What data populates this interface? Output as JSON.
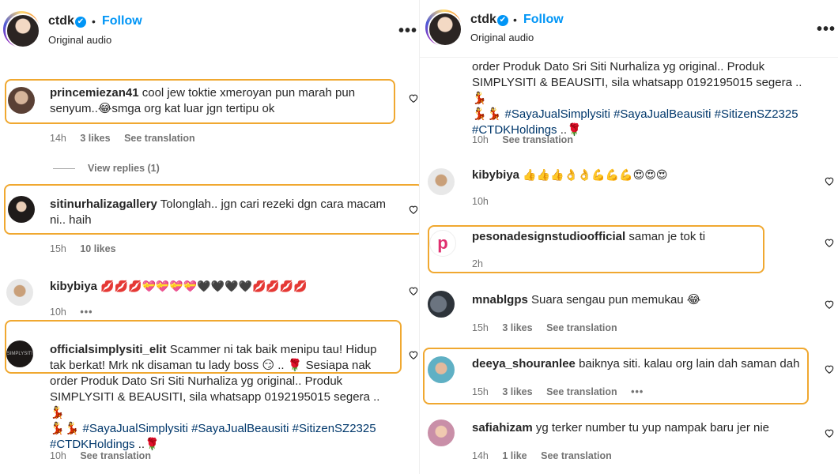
{
  "header": {
    "username": "ctdk",
    "verified_icon": "✔",
    "separator": "•",
    "follow_label": "Follow",
    "audio_label": "Original audio",
    "more_label": "•••"
  },
  "left": {
    "comments": [
      {
        "user": "princemiezan41",
        "text": "cool jew toktie xmeroyan pun marah pun senyum..😂smga org kat luar jgn tertipu ok",
        "time": "14h",
        "likes": "3 likes",
        "translate": "See translation"
      },
      {
        "user": "sitinurhalizagallery",
        "text": "Tolonglah.. jgn cari rezeki dgn cara macam ni.. haih",
        "time": "15h",
        "likes": "10 likes"
      },
      {
        "user": "kibybiya",
        "text": "💋💋💋💝💝💝💝🖤🖤🖤🖤💋💋💋💋",
        "time": "10h",
        "more": "•••"
      },
      {
        "user": "officialsimplysiti_elit",
        "text": "Scammer ni tak baik menipu tau! Hidup tak berkat! Mrk nk disaman tu lady boss 😏 .. 🌹 Sesiapa nak order Produk Dato Sri Siti Nurhaliza yg original.. Produk SIMPLYSITI & BEAUSITI, sila whatsapp 0192195015 segera .. 💃",
        "text_tail": "💃💃",
        "tags": "#SayaJualSimplysiti #SayaJualBeausiti #SitizenSZ2325",
        "tags2": "#CTDKHoldings",
        "tags2_tail": " ..🌹",
        "time": "10h",
        "translate": "See translation"
      }
    ],
    "view_replies": "View replies (1)",
    "avatar_text_official": "SIMPLYSITI"
  },
  "right": {
    "top_fragment": "order Produk Dato Sri Siti Nurhaliza yg original.. Produk SIMPLYSITI & BEAUSITI, sila whatsapp 0192195015 segera .. 💃",
    "top_fragment_tail": "💃💃",
    "top_tags": "#SayaJualSimplysiti #SayaJualBeausiti #SitizenSZ2325",
    "top_tags2": "#CTDKHoldings",
    "top_tags2_tail": " ..🌹",
    "top_time": "10h",
    "top_translate": "See translation",
    "comments": [
      {
        "user": "kibybiya",
        "text": "👍👍👍👌👌💪💪💪😍😍😍",
        "time": "10h"
      },
      {
        "user": "pesonadesignstudioofficial",
        "text": "saman je tok ti",
        "time": "2h",
        "avatar_letter": "p"
      },
      {
        "user": "mnablgps",
        "text": "Suara sengau pun memukau 😂",
        "time": "15h",
        "likes": "3 likes",
        "translate": "See translation"
      },
      {
        "user": "deeya_shouranlee",
        "text": "baiknya siti. kalau org lain dah saman dah",
        "time": "15h",
        "likes": "3 likes",
        "translate": "See translation",
        "more": "•••"
      },
      {
        "user": "safiahizam",
        "text": "yg terker number tu yup nampak baru jer nie",
        "time": "14h",
        "likes": "1 like",
        "translate": "See translation"
      }
    ]
  },
  "colors": {
    "accent": "#0095f6",
    "highlight": "#f0a830",
    "hashtag": "#00376b",
    "muted": "#737373"
  }
}
